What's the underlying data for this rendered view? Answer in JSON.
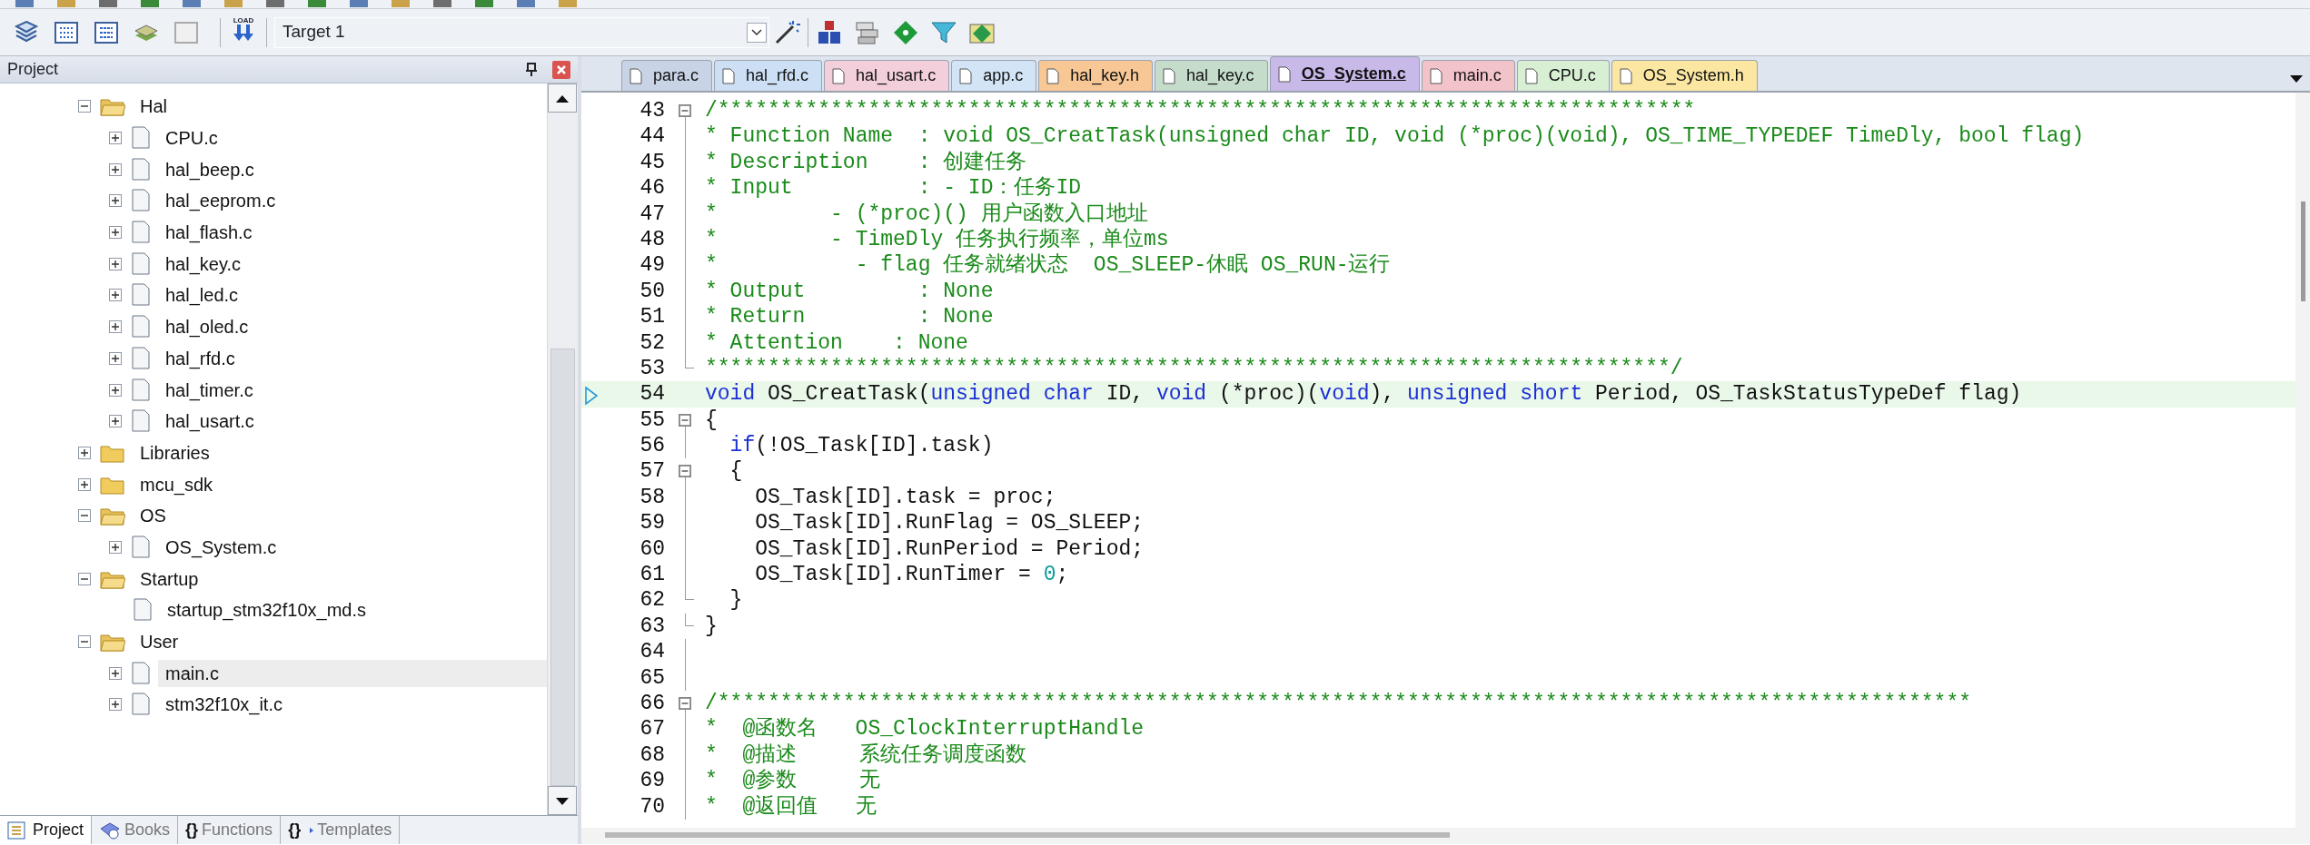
{
  "toolbar": {
    "load_label": "LOAD",
    "target": "Target 1"
  },
  "project_panel": {
    "title": "Project",
    "tree": [
      {
        "label": "Hal",
        "kind": "folder",
        "expandable": true,
        "expanded": true,
        "selected": false,
        "children": [
          {
            "label": "CPU.c",
            "kind": "file",
            "expandable": true,
            "expanded": false,
            "selected": false
          },
          {
            "label": "hal_beep.c",
            "kind": "file",
            "expandable": true,
            "expanded": false,
            "selected": false
          },
          {
            "label": "hal_eeprom.c",
            "kind": "file",
            "expandable": true,
            "expanded": false,
            "selected": false
          },
          {
            "label": "hal_flash.c",
            "kind": "file",
            "expandable": true,
            "expanded": false,
            "selected": false
          },
          {
            "label": "hal_key.c",
            "kind": "file",
            "expandable": true,
            "expanded": false,
            "selected": false
          },
          {
            "label": "hal_led.c",
            "kind": "file",
            "expandable": true,
            "expanded": false,
            "selected": false
          },
          {
            "label": "hal_oled.c",
            "kind": "file",
            "expandable": true,
            "expanded": false,
            "selected": false
          },
          {
            "label": "hal_rfd.c",
            "kind": "file",
            "expandable": true,
            "expanded": false,
            "selected": false
          },
          {
            "label": "hal_timer.c",
            "kind": "file",
            "expandable": true,
            "expanded": false,
            "selected": false
          },
          {
            "label": "hal_usart.c",
            "kind": "file",
            "expandable": true,
            "expanded": false,
            "selected": false
          }
        ]
      },
      {
        "label": "Libraries",
        "kind": "folder",
        "expandable": true,
        "expanded": false,
        "selected": false
      },
      {
        "label": "mcu_sdk",
        "kind": "folder",
        "expandable": true,
        "expanded": false,
        "selected": false
      },
      {
        "label": "OS",
        "kind": "folder",
        "expandable": true,
        "expanded": true,
        "selected": false,
        "children": [
          {
            "label": "OS_System.c",
            "kind": "file",
            "expandable": true,
            "expanded": false,
            "selected": false
          }
        ]
      },
      {
        "label": "Startup",
        "kind": "folder",
        "expandable": true,
        "expanded": true,
        "selected": false,
        "children": [
          {
            "label": "startup_stm32f10x_md.s",
            "kind": "file",
            "expandable": false,
            "selected": false
          }
        ]
      },
      {
        "label": "User",
        "kind": "folder",
        "expandable": true,
        "expanded": true,
        "selected": false,
        "children": [
          {
            "label": "main.c",
            "kind": "file",
            "expandable": true,
            "expanded": false,
            "selected": true
          },
          {
            "label": "stm32f10x_it.c",
            "kind": "file",
            "expandable": true,
            "expanded": false,
            "selected": false
          }
        ]
      }
    ],
    "tabs": [
      {
        "label": "Project",
        "kind": "project",
        "selected": true
      },
      {
        "label": "Books",
        "kind": "books",
        "selected": false
      },
      {
        "label": "{}",
        "kind": "functions",
        "selected": false,
        "text": "Functions"
      },
      {
        "label": "{}",
        "kind": "templates",
        "selected": false,
        "text": "Templates"
      }
    ]
  },
  "editor": {
    "tabs": [
      {
        "label": "para.c",
        "color": "#c9d3e6",
        "selected": false
      },
      {
        "label": "hal_rfd.c",
        "color": "#cddff5",
        "selected": false
      },
      {
        "label": "hal_usart.c",
        "color": "#f3cfdc",
        "selected": false
      },
      {
        "label": "app.c",
        "color": "#d3e4f7",
        "selected": false
      },
      {
        "label": "hal_key.h",
        "color": "#f7c795",
        "selected": false
      },
      {
        "label": "hal_key.c",
        "color": "#c5dccb",
        "selected": false
      },
      {
        "label": "OS_System.c",
        "color": "#c9b9e9",
        "selected": true
      },
      {
        "label": "main.c",
        "color": "#f3c3ca",
        "selected": false
      },
      {
        "label": "CPU.c",
        "color": "#d9efd4",
        "selected": false
      },
      {
        "label": "OS_System.h",
        "color": "#fbe7a1",
        "selected": false
      }
    ],
    "lines": [
      {
        "number": "43",
        "fold_start": true,
        "fold_end": false,
        "in_fold": false,
        "current": false,
        "tokens": [
          {
            "kind": "comment",
            "text": "/******************************************************************************"
          }
        ]
      },
      {
        "number": "44",
        "fold_start": false,
        "fold_end": false,
        "in_fold": true,
        "current": false,
        "tokens": [
          {
            "kind": "comment",
            "text": "* Function Name  : void OS_CreatTask(unsigned char ID, void (*proc)(void), OS_TIME_TYPEDEF TimeDly, bool flag)"
          }
        ]
      },
      {
        "number": "45",
        "fold_start": false,
        "fold_end": false,
        "in_fold": true,
        "current": false,
        "tokens": [
          {
            "kind": "comment",
            "text": "* Description    : 创建任务"
          }
        ]
      },
      {
        "number": "46",
        "fold_start": false,
        "fold_end": false,
        "in_fold": true,
        "current": false,
        "tokens": [
          {
            "kind": "comment",
            "text": "* Input          : - ID：任务ID"
          }
        ]
      },
      {
        "number": "47",
        "fold_start": false,
        "fold_end": false,
        "in_fold": true,
        "current": false,
        "tokens": [
          {
            "kind": "comment",
            "text": "*         - (*proc)() 用户函数入口地址"
          }
        ]
      },
      {
        "number": "48",
        "fold_start": false,
        "fold_end": false,
        "in_fold": true,
        "current": false,
        "tokens": [
          {
            "kind": "comment",
            "text": "*         - TimeDly 任务执行频率，单位ms"
          }
        ]
      },
      {
        "number": "49",
        "fold_start": false,
        "fold_end": false,
        "in_fold": true,
        "current": false,
        "tokens": [
          {
            "kind": "comment",
            "text": "*           - flag 任务就绪状态  OS_SLEEP-休眠 OS_RUN-运行"
          }
        ]
      },
      {
        "number": "50",
        "fold_start": false,
        "fold_end": false,
        "in_fold": true,
        "current": false,
        "tokens": [
          {
            "kind": "comment",
            "text": "* Output         : None"
          }
        ]
      },
      {
        "number": "51",
        "fold_start": false,
        "fold_end": false,
        "in_fold": true,
        "current": false,
        "tokens": [
          {
            "kind": "comment",
            "text": "* Return         : None"
          }
        ]
      },
      {
        "number": "52",
        "fold_start": false,
        "fold_end": false,
        "in_fold": true,
        "current": false,
        "tokens": [
          {
            "kind": "comment",
            "text": "* Attention    : None"
          }
        ]
      },
      {
        "number": "53",
        "fold_start": false,
        "fold_end": true,
        "in_fold": false,
        "current": false,
        "tokens": [
          {
            "kind": "comment",
            "text": "*****************************************************************************/"
          }
        ]
      },
      {
        "number": "54",
        "fold_start": false,
        "fold_end": false,
        "in_fold": false,
        "current": true,
        "tokens": [
          {
            "kind": "keyword",
            "text": "void"
          },
          {
            "kind": "plain",
            "text": " OS_CreatTask("
          },
          {
            "kind": "keyword",
            "text": "unsigned char"
          },
          {
            "kind": "plain",
            "text": " ID, "
          },
          {
            "kind": "keyword",
            "text": "void"
          },
          {
            "kind": "plain",
            "text": " (*proc)("
          },
          {
            "kind": "keyword",
            "text": "void"
          },
          {
            "kind": "plain",
            "text": "), "
          },
          {
            "kind": "keyword",
            "text": "unsigned short"
          },
          {
            "kind": "plain",
            "text": " Period, OS_TaskStatusTypeDef flag)"
          }
        ]
      },
      {
        "number": "55",
        "fold_start": true,
        "fold_end": false,
        "in_fold": false,
        "current": false,
        "tokens": [
          {
            "kind": "plain",
            "text": "{"
          }
        ]
      },
      {
        "number": "56",
        "fold_start": false,
        "fold_end": false,
        "in_fold": true,
        "current": false,
        "tokens": [
          {
            "kind": "keyword",
            "text": "  if"
          },
          {
            "kind": "plain",
            "text": "(!OS_Task[ID].task)"
          }
        ]
      },
      {
        "number": "57",
        "fold_start": true,
        "fold_end": false,
        "in_fold": false,
        "current": false,
        "tokens": [
          {
            "kind": "plain",
            "text": "  {"
          }
        ]
      },
      {
        "number": "58",
        "fold_start": false,
        "fold_end": false,
        "in_fold": true,
        "current": false,
        "tokens": [
          {
            "kind": "plain",
            "text": "    OS_Task[ID].task = proc;"
          }
        ]
      },
      {
        "number": "59",
        "fold_start": false,
        "fold_end": false,
        "in_fold": true,
        "current": false,
        "tokens": [
          {
            "kind": "plain",
            "text": "    OS_Task[ID].RunFlag = OS_SLEEP;"
          }
        ]
      },
      {
        "number": "60",
        "fold_start": false,
        "fold_end": false,
        "in_fold": true,
        "current": false,
        "tokens": [
          {
            "kind": "plain",
            "text": "    OS_Task[ID].RunPeriod = Period;"
          }
        ]
      },
      {
        "number": "61",
        "fold_start": false,
        "fold_end": false,
        "in_fold": true,
        "current": false,
        "tokens": [
          {
            "kind": "plain",
            "text": "    OS_Task[ID].RunTimer = "
          },
          {
            "kind": "number",
            "text": "0"
          },
          {
            "kind": "plain",
            "text": ";"
          }
        ]
      },
      {
        "number": "62",
        "fold_start": false,
        "fold_end": true,
        "in_fold": false,
        "current": false,
        "tokens": [
          {
            "kind": "plain",
            "text": "  }"
          }
        ]
      },
      {
        "number": "63",
        "fold_start": false,
        "fold_end": true,
        "in_fold": false,
        "current": false,
        "tokens": [
          {
            "kind": "plain",
            "text": "}"
          }
        ]
      },
      {
        "number": "64",
        "fold_start": false,
        "fold_end": false,
        "in_fold": true,
        "current": false
      },
      {
        "number": "65",
        "fold_start": false,
        "fold_end": false,
        "in_fold": true,
        "current": false
      },
      {
        "number": "66",
        "fold_start": true,
        "fold_end": false,
        "in_fold": false,
        "current": false,
        "tokens": [
          {
            "kind": "comment",
            "text": "/****************************************************************************************************"
          }
        ]
      },
      {
        "number": "67",
        "fold_start": false,
        "fold_end": false,
        "in_fold": true,
        "current": false,
        "tokens": [
          {
            "kind": "comment",
            "text": "*  @函数名   OS_ClockInterruptHandle"
          }
        ]
      },
      {
        "number": "68",
        "fold_start": false,
        "fold_end": false,
        "in_fold": true,
        "current": false,
        "tokens": [
          {
            "kind": "comment",
            "text": "*  @描述     系统任务调度函数"
          }
        ]
      },
      {
        "number": "69",
        "fold_start": false,
        "fold_end": false,
        "in_fold": true,
        "current": false,
        "tokens": [
          {
            "kind": "comment",
            "text": "*  @参数     无"
          }
        ]
      },
      {
        "number": "70",
        "fold_start": false,
        "fold_end": false,
        "in_fold": true,
        "current": false,
        "tokens": [
          {
            "kind": "comment",
            "text": "*  @返回值   无"
          }
        ]
      }
    ]
  }
}
